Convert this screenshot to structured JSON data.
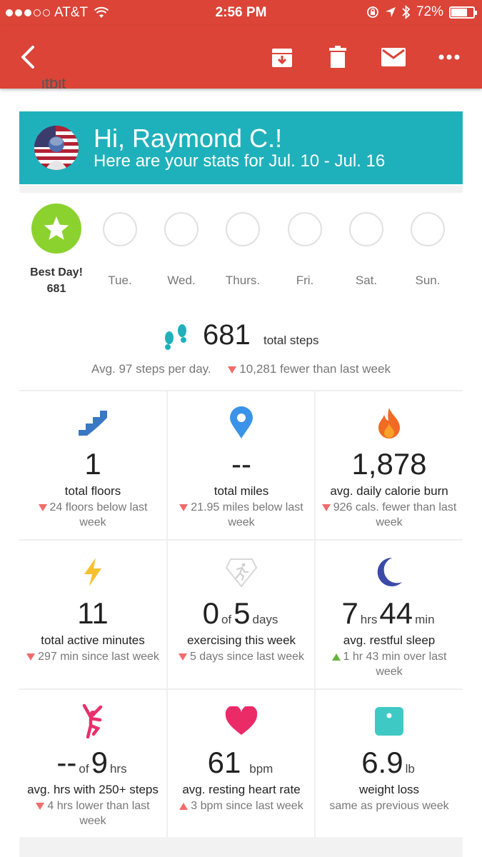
{
  "status_bar": {
    "carrier": "AT&T",
    "time": "2:56 PM",
    "battery": "72%",
    "battery_level": 0.72,
    "signal_bars": 3
  },
  "toolbar": {
    "icons": [
      "back-arrow-icon",
      "archive-icon",
      "trash-icon",
      "mail-icon",
      "more-icon"
    ]
  },
  "email_peek_text": "itbit",
  "banner": {
    "greeting": "Hi, Raymond C.!",
    "subtitle": "Here are your stats for Jul. 10 - Jul. 16",
    "color": "#1fb1bb"
  },
  "days": {
    "best_label": "Best Day!",
    "best_value": "681",
    "others": [
      "Tue.",
      "Wed.",
      "Thurs.",
      "Fri.",
      "Sat.",
      "Sun."
    ]
  },
  "steps": {
    "value": "681",
    "label": "total steps",
    "avg": "Avg. 97 steps per day.",
    "compare": "10,281 fewer than last week"
  },
  "stats": [
    {
      "icon": "stairs-icon",
      "value": "1",
      "label": "total floors",
      "trend": "down",
      "compare": "24 floors below last week"
    },
    {
      "icon": "location-pin-icon",
      "value": "--",
      "label": "total miles",
      "trend": "down",
      "compare": "21.95 miles below last week"
    },
    {
      "icon": "flame-icon",
      "value": "1,878",
      "label": "avg. daily calorie burn",
      "trend": "down",
      "compare": "926 cals. fewer than last week"
    },
    {
      "icon": "lightning-icon",
      "value": "11",
      "label": "total active minutes",
      "trend": "down",
      "compare": "297 min since last week"
    },
    {
      "icon": "exercise-badge-icon",
      "value": "0",
      "of": "of",
      "value2": "5",
      "unit": "days",
      "label": "exercising this week",
      "trend": "down",
      "compare": "5 days since last week"
    },
    {
      "icon": "moon-icon",
      "value": "7",
      "unit1": "hrs",
      "value2": "44",
      "unit2": "min",
      "label": "avg. restful sleep",
      "trend": "up",
      "compare": "1 hr 43 min over last week"
    },
    {
      "icon": "stretching-person-icon",
      "value": "--",
      "of": "of",
      "value2": "9",
      "unit": "hrs",
      "label": "avg. hrs with 250+ steps",
      "trend": "down",
      "compare": "4 hrs lower than last week"
    },
    {
      "icon": "heart-icon",
      "value": "61",
      "unit": "bpm",
      "label": "avg. resting heart rate",
      "trend": "up-red",
      "compare": "3 bpm since last week"
    },
    {
      "icon": "scale-icon",
      "value": "6.9",
      "unit": "lb",
      "label": "weight loss",
      "trend": "none",
      "compare": "same as previous week"
    }
  ],
  "colors": {
    "header_red": "#db4437",
    "best_day_green": "#8bd22f",
    "down_arrow": "#f26b6b",
    "up_arrow_green": "#67b33a"
  }
}
